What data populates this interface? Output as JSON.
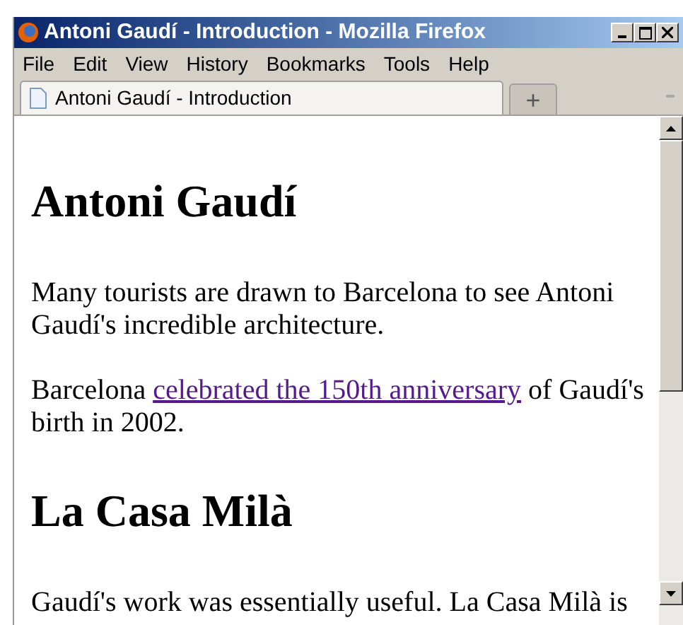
{
  "window": {
    "title": "Antoni Gaudí - Introduction - Mozilla Firefox"
  },
  "menu": [
    "File",
    "Edit",
    "View",
    "History",
    "Bookmarks",
    "Tools",
    "Help"
  ],
  "tabs": [
    {
      "label": "Antoni Gaudí - Introduction",
      "selected": true
    }
  ],
  "new_tab": "+",
  "content": [
    {
      "kind": "heading",
      "text": "Antoni Gaudí"
    },
    {
      "kind": "paragraph",
      "text": "Many tourists are drawn to Barcelona to see Antoni Gaudí's incredible architecture."
    },
    {
      "kind": "link_paragraph",
      "before": "Barcelona ",
      "link": "celebrated the 150th anniversary",
      "after": " of Gaudí's birth in 2002."
    },
    {
      "kind": "heading",
      "text": "La Casa Milà"
    },
    {
      "kind": "paragraph",
      "text": "Gaudí's work was essentially useful. La Casa Milà is"
    }
  ]
}
